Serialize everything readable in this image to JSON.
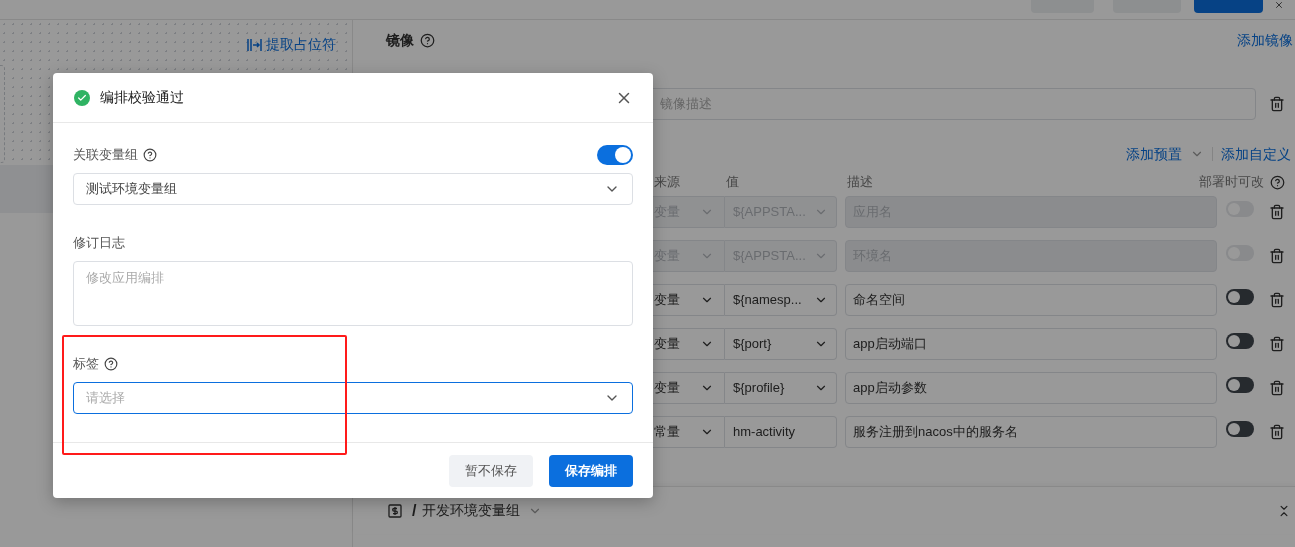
{
  "canvas": {
    "link": "提取占位符"
  },
  "image_section": {
    "title": "镜像",
    "link": "添加镜像",
    "description_placeholder": "镜像描述"
  },
  "variables": {
    "links": [
      "添加预置",
      "添加自定义"
    ],
    "columns": [
      "来源",
      "值",
      "描述",
      "部署时可改"
    ],
    "rows": [
      {
        "source": "变量",
        "value": "${APPSTA...",
        "description": "应用名",
        "disabled": true,
        "on": false
      },
      {
        "source": "变量",
        "value": "${APPSTA...",
        "description": "环境名",
        "disabled": true,
        "on": false
      },
      {
        "source": "变量",
        "value": "${namesp...",
        "description": "命名空间",
        "disabled": false,
        "on": false
      },
      {
        "source": "变量",
        "value": "${port}",
        "description": "app启动端口",
        "disabled": false,
        "on": false
      },
      {
        "source": "变量",
        "value": "${profile}",
        "description": "app启动参数",
        "disabled": false,
        "on": false
      },
      {
        "source": "常量",
        "value": "hm-activity",
        "description": "服务注册到nacos中的服务名",
        "disabled": false,
        "on": false,
        "kind": "text"
      }
    ]
  },
  "group": {
    "separator": "/",
    "title": "开发环境变量组"
  },
  "modal": {
    "title": "编排校验通过",
    "fields": [
      {
        "kind": "select",
        "label": "关联变量组",
        "help": true,
        "toggle": {
          "on": true
        },
        "value": "测试环境变量组"
      },
      {
        "kind": "textarea",
        "label": "修订日志",
        "help": false,
        "placeholder": "修改应用编排"
      },
      {
        "kind": "select",
        "label": "标签",
        "help": true,
        "placeholder": "请选择",
        "focused": true
      }
    ],
    "buttons": [
      {
        "label": "暂不保存",
        "primary": false
      },
      {
        "label": "保存编排",
        "primary": true
      }
    ]
  }
}
